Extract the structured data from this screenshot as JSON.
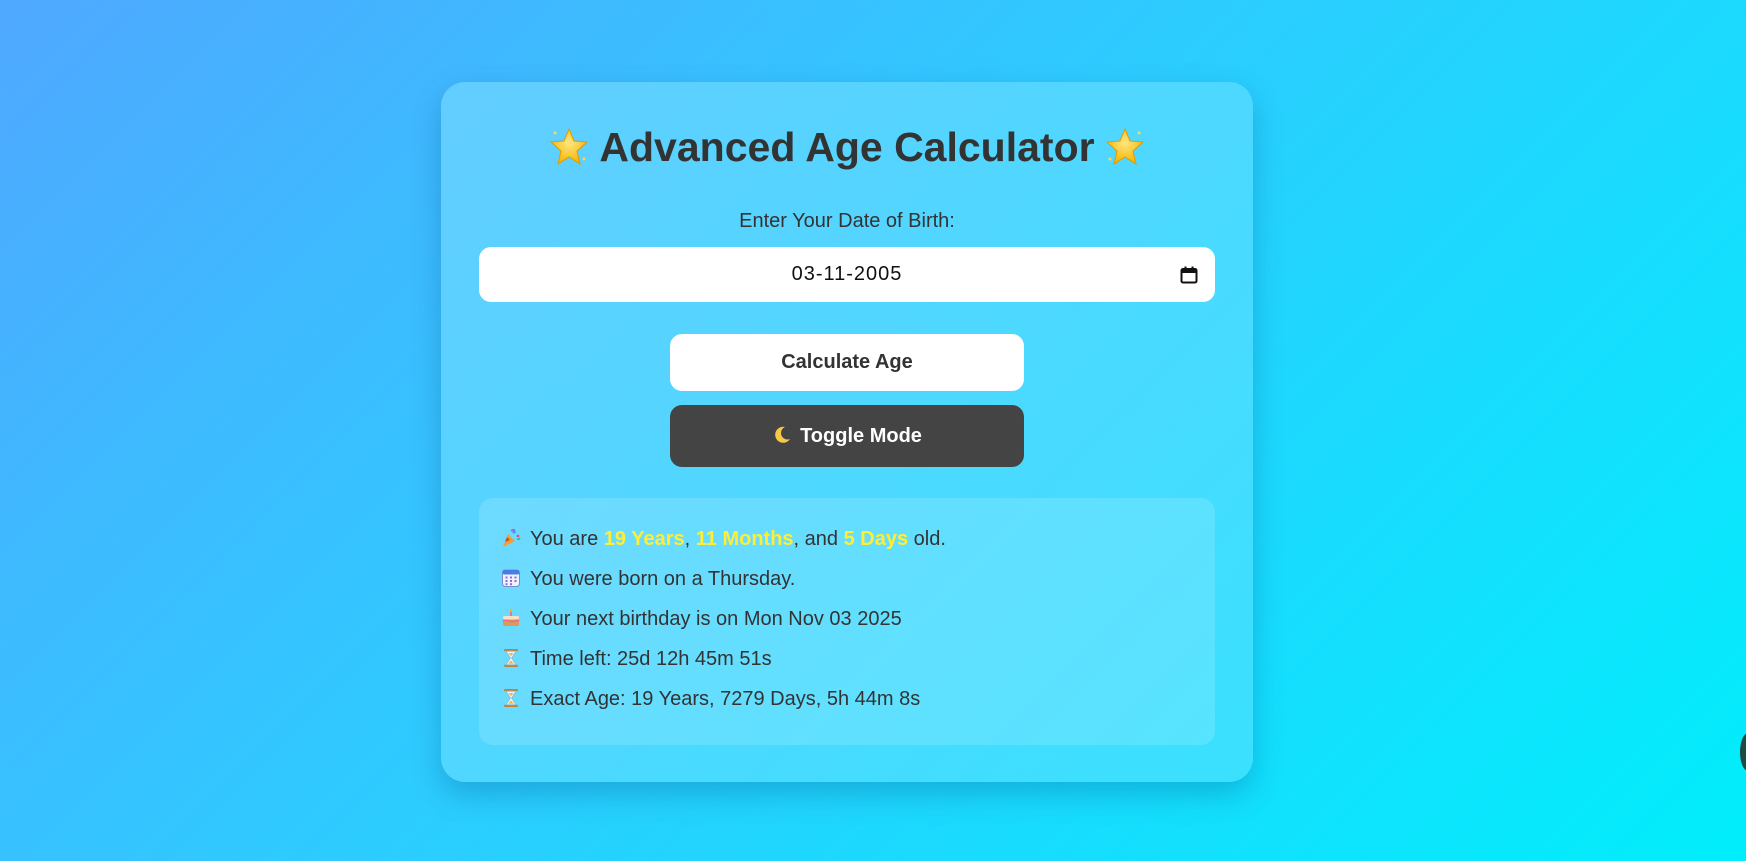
{
  "app": {
    "title": "Advanced Age Calculator"
  },
  "form": {
    "dob_label": "Enter Your Date of Birth:",
    "dob_value": "03-11-2005",
    "calculate_label": "Calculate Age",
    "toggle_label": "Toggle Mode"
  },
  "result": {
    "age_prefix": "You are",
    "years": "19 Years",
    "sep1": ",",
    "months": "11 Months",
    "sep2": ", and",
    "days": "5 Days",
    "age_suffix": "old.",
    "born_day": "You were born on a Thursday.",
    "next_birthday": "Your next birthday is on Mon Nov 03 2025",
    "time_left": "Time left: 25d 12h 45m 51s",
    "exact_age": "Exact Age: 19 Years, 7279 Days, 5h 44m 8s"
  },
  "icons": {
    "title_left": "star-icon",
    "title_right": "star-icon",
    "dob_picker": "calendar-icon",
    "toggle": "moon-icon",
    "line1": "party-popper-icon",
    "line2": "calendar-icon",
    "line3": "birthday-cake-icon",
    "line4": "hourglass-icon",
    "line5": "hourglass-icon"
  },
  "colors": {
    "background_start": "#4fa8ff",
    "background_end": "#00eefc",
    "highlight": "#ffee33",
    "toggle_button": "#444444",
    "text": "#333333"
  }
}
